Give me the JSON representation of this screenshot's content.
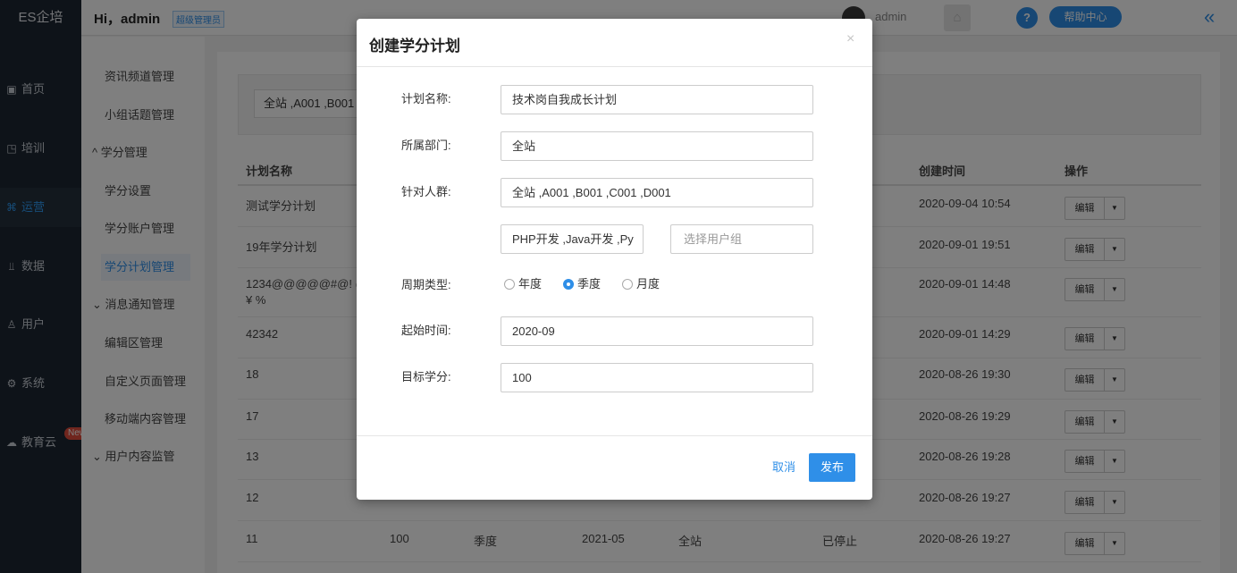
{
  "app": {
    "brand": "ES企培"
  },
  "left_nav": [
    {
      "label": "首页",
      "icon": "home-icon",
      "glyph": "▣"
    },
    {
      "label": "培训",
      "icon": "training-icon",
      "glyph": "◳"
    },
    {
      "label": "运营",
      "icon": "operations-icon",
      "glyph": "⌘"
    },
    {
      "label": "数据",
      "icon": "chart-icon",
      "glyph": "⫫"
    },
    {
      "label": "用户",
      "icon": "user-icon",
      "glyph": "♙"
    },
    {
      "label": "系统",
      "icon": "settings-icon",
      "glyph": "⚙"
    },
    {
      "label": "教育云",
      "icon": "cloud-icon",
      "glyph": "☁"
    }
  ],
  "new_badge": "New",
  "header": {
    "greeting": "Hi，admin",
    "role": "超级管理员",
    "user": "admin",
    "help": "帮助中心",
    "help_icon": "?",
    "home_icon": "⌂",
    "collapse_icon": "«"
  },
  "sub_nav": {
    "items": [
      {
        "label": "资讯频道管理"
      },
      {
        "label": "小组话题管理"
      },
      {
        "label": "学分管理"
      },
      {
        "label": "学分设置"
      },
      {
        "label": "学分账户管理"
      },
      {
        "label": "学分计划管理"
      },
      {
        "label": "消息通知管理"
      },
      {
        "label": "编辑区管理"
      },
      {
        "label": "自定义页面管理"
      },
      {
        "label": "移动端内容管理"
      },
      {
        "label": "用户内容监管"
      }
    ],
    "group_up": "^",
    "group_down": "⌄"
  },
  "filter": {
    "audience_value": "全站 ,A001 ,B001"
  },
  "table": {
    "headers": {
      "name": "计划名称",
      "created": "创建时间",
      "ops": "操作"
    },
    "rows": [
      {
        "name": "测试学分计划",
        "created": "2020-09-04 10:54"
      },
      {
        "name": "19年学分计划",
        "created": "2020-09-01 19:51"
      },
      {
        "name": "1234@@@@@#@! @",
        "name2": "¥ %",
        "created": "2020-09-01 14:48"
      },
      {
        "name": "42342",
        "created": "2020-09-01 14:29"
      },
      {
        "name": "18",
        "created": "2020-08-26 19:30"
      },
      {
        "name": "17",
        "created": "2020-08-26 19:29"
      },
      {
        "name": "13",
        "created": "2020-08-26 19:28"
      },
      {
        "name": "12",
        "created": "2020-08-26 19:27"
      },
      {
        "name": "11",
        "target": "100",
        "cycle": "季度",
        "start": "2021-05",
        "dept": "全站",
        "status": "已停止",
        "created": "2020-08-26 19:27"
      }
    ],
    "edit_label": "编辑",
    "caret": "▼"
  },
  "modal": {
    "title": "创建学分计划",
    "close": "×",
    "labels": {
      "name": "计划名称:",
      "dept": "所属部门:",
      "audience": "针对人群:",
      "cycle": "周期类型:",
      "start": "起始时间:",
      "target": "目标学分:"
    },
    "values": {
      "name": "技术岗自我成长计划",
      "dept": "全站",
      "audience": "全站 ,A001 ,B001 ,C001 ,D001",
      "user_groups": "PHP开发 ,Java开发 ,Py",
      "user_group_placeholder": "选择用户组",
      "start": "2020-09",
      "target": "100"
    },
    "cycle_options": [
      {
        "label": "年度",
        "checked": false
      },
      {
        "label": "季度",
        "checked": true
      },
      {
        "label": "月度",
        "checked": false
      }
    ],
    "cancel": "取消",
    "publish": "发布"
  }
}
